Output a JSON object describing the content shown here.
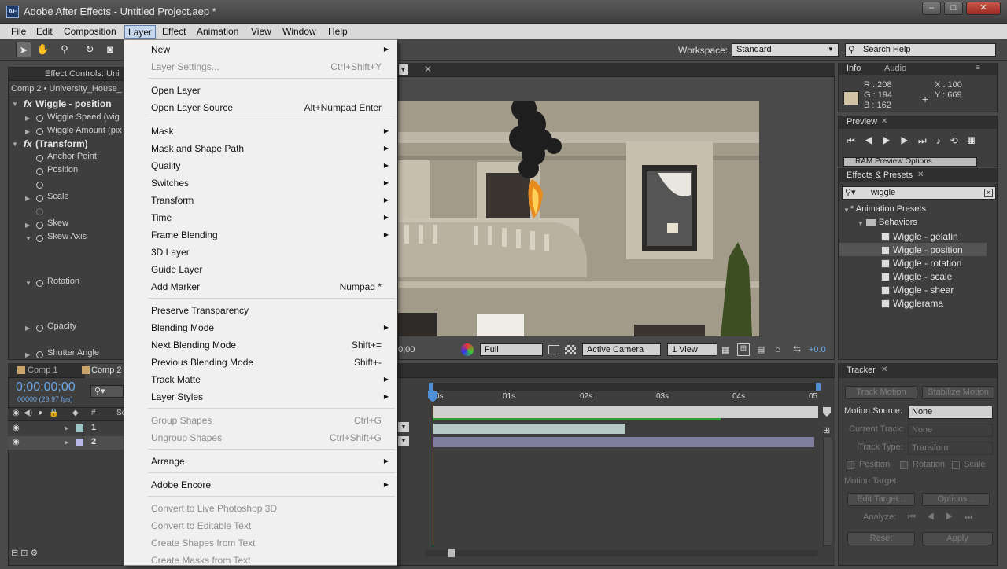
{
  "window": {
    "title": "Adobe After Effects - Untitled Project.aep *",
    "icon": "AE",
    "min": "–",
    "max": "□",
    "close": "✕"
  },
  "menubar": [
    "File",
    "Edit",
    "Composition",
    "Layer",
    "Effect",
    "Animation",
    "View",
    "Window",
    "Help"
  ],
  "toolbar": {
    "workspace_label": "Workspace:",
    "workspace_value": "Standard",
    "search_placeholder": "Search Help"
  },
  "effect_controls": {
    "tab": "Effect Controls: Uni",
    "breadcrumb": "Comp 2 • University_House_",
    "effect1": "Wiggle - position",
    "wiggle_speed": "Wiggle Speed (wig",
    "wiggle_amount": "Wiggle Amount (pix",
    "effect2": "(Transform)",
    "anchor": "Anchor Point",
    "position": "Position",
    "scale": "Scale",
    "skew": "Skew",
    "skew_axis": "Skew Axis",
    "rotation": "Rotation",
    "opacity": "Opacity",
    "shutter": "Shutter Angle",
    "fx": "fx"
  },
  "viewer": {
    "timecode_frag": "0;00",
    "resolution": "Full",
    "camera": "Active Camera",
    "views": "1 View",
    "exposure": "+0.0"
  },
  "timeline": {
    "tabs": [
      "Comp 1",
      "Comp 2"
    ],
    "timecode": "0;00;00;00",
    "fps": "00000 (29.97 fps)",
    "hash": "#",
    "src": "So",
    "layer_numbers": [
      "1",
      "2"
    ],
    "ruler": [
      "0s",
      "01s",
      "02s",
      "03s",
      "04s",
      "05"
    ]
  },
  "info": {
    "tabs": [
      "Info",
      "Audio"
    ],
    "r": "R : 208",
    "g": "G : 194",
    "b": "B : 162",
    "x": "X : 100",
    "y": "Y : 669",
    "swatch": "#d0c2a2"
  },
  "preview": {
    "tab": "Preview",
    "ram": "RAM Preview Options"
  },
  "effects_presets": {
    "tab": "Effects & Presets",
    "search": "wiggle",
    "root": "* Animation Presets",
    "folder": "Behaviors",
    "items": [
      "Wiggle - gelatin",
      "Wiggle - position",
      "Wiggle - rotation",
      "Wiggle - scale",
      "Wiggle - shear",
      "Wigglerama"
    ]
  },
  "tracker": {
    "tab": "Tracker",
    "track_motion": "Track Motion",
    "stabilize": "Stabilize Motion",
    "motion_source_label": "Motion Source:",
    "motion_source_value": "None",
    "current_track_label": "Current Track:",
    "current_track_value": "None",
    "track_type_label": "Track Type:",
    "track_type_value": "Transform",
    "position": "Position",
    "rotation": "Rotation",
    "scale": "Scale",
    "motion_target": "Motion Target:",
    "edit_target": "Edit Target...",
    "options": "Options...",
    "analyze": "Analyze:",
    "reset": "Reset",
    "apply": "Apply"
  },
  "layer_menu": {
    "new": "New",
    "layer_settings": "Layer Settings...",
    "layer_settings_sc": "Ctrl+Shift+Y",
    "open_layer": "Open Layer",
    "open_layer_source": "Open Layer Source",
    "open_layer_source_sc": "Alt+Numpad Enter",
    "mask": "Mask",
    "mask_shape_path": "Mask and Shape Path",
    "quality": "Quality",
    "switches": "Switches",
    "transform": "Transform",
    "time": "Time",
    "frame_blending": "Frame Blending",
    "layer_3d": "3D Layer",
    "guide_layer": "Guide Layer",
    "add_marker": "Add Marker",
    "add_marker_sc": "Numpad *",
    "preserve_transparency": "Preserve Transparency",
    "blending_mode": "Blending Mode",
    "next_blending": "Next Blending Mode",
    "next_blending_sc": "Shift+=",
    "prev_blending": "Previous Blending Mode",
    "prev_blending_sc": "Shift+-",
    "track_matte": "Track Matte",
    "layer_styles": "Layer Styles",
    "group_shapes": "Group Shapes",
    "group_shapes_sc": "Ctrl+G",
    "ungroup_shapes": "Ungroup Shapes",
    "ungroup_shapes_sc": "Ctrl+Shift+G",
    "arrange": "Arrange",
    "adobe_encore": "Adobe Encore",
    "convert_ps3d": "Convert to Live Photoshop 3D",
    "convert_text": "Convert to Editable Text",
    "shapes_from_text": "Create Shapes from Text",
    "masks_from_text": "Create Masks from Text"
  }
}
